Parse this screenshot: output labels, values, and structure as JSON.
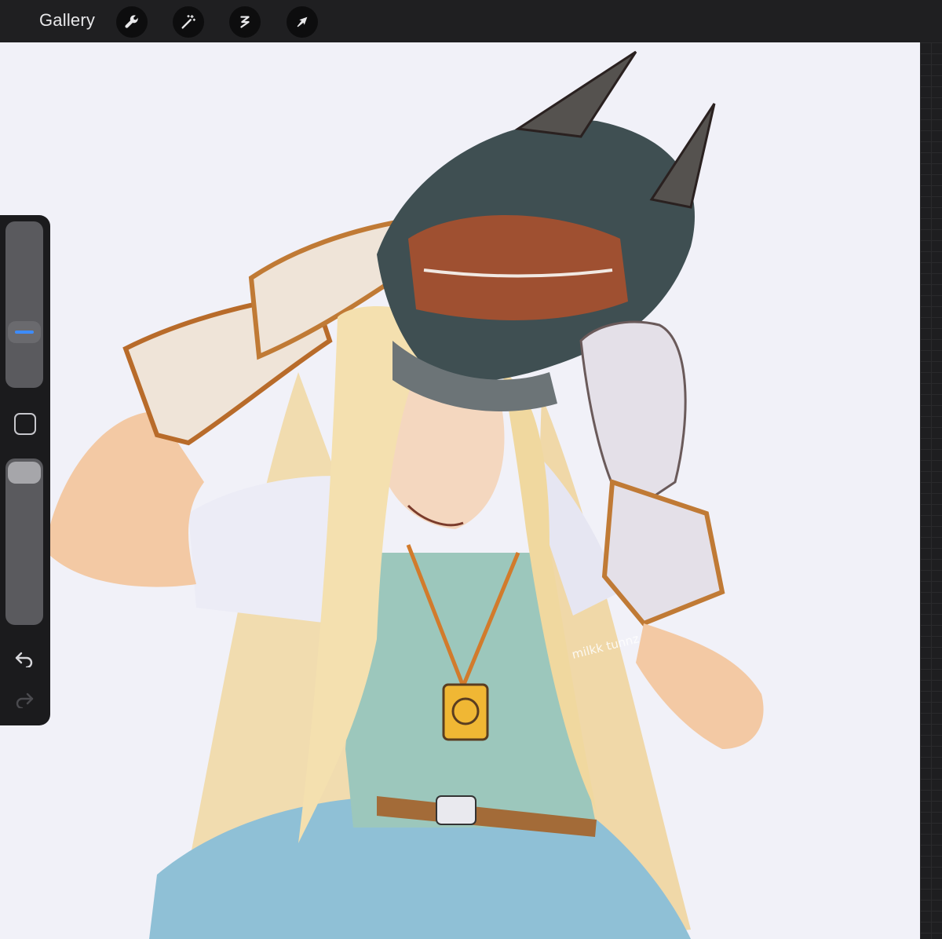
{
  "topbar": {
    "gallery_label": "Gallery",
    "tools": [
      {
        "name": "actions",
        "icon": "wrench-icon"
      },
      {
        "name": "adjustments",
        "icon": "magic-wand-icon"
      },
      {
        "name": "selection",
        "icon": "selection-s-icon"
      },
      {
        "name": "transform",
        "icon": "arrow-cursor-icon"
      }
    ]
  },
  "sidebar": {
    "brush_size_level": 0.3,
    "opacity_level": 1.0,
    "modify_icon": "square-icon",
    "undo_icon": "undo-icon",
    "redo_icon": "redo-icon"
  },
  "canvas": {
    "artwork": "illustration",
    "signature": "milkk tunnz"
  },
  "colors": {
    "toolbar_bg": "#1f1f21",
    "canvas_bg": "#f1f1f8",
    "accent": "#3d8cff"
  }
}
